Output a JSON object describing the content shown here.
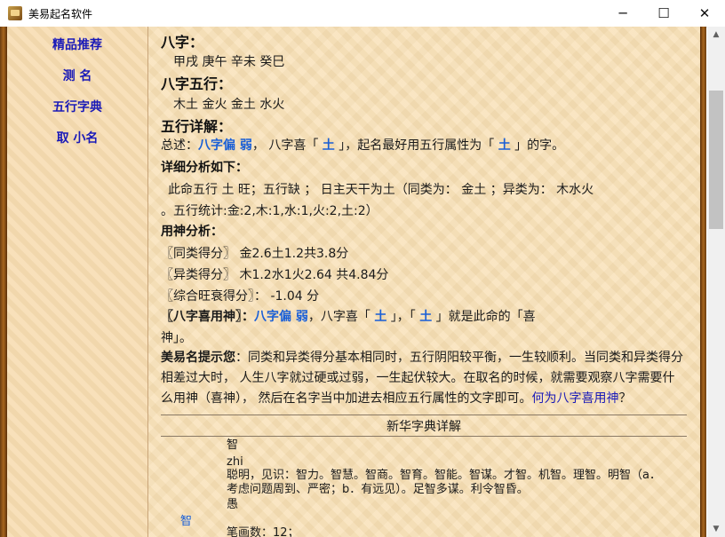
{
  "window": {
    "title": "美易起名软件",
    "minimize_glyph": "─",
    "maximize_glyph": "☐",
    "close_glyph": "✕"
  },
  "sidebar": {
    "items": [
      {
        "label": "精品推荐"
      },
      {
        "label": "测 名"
      },
      {
        "label": "五行字典"
      },
      {
        "label": "取 小名"
      }
    ]
  },
  "content": {
    "bazi_heading": "八字：",
    "bazi_value": "甲戌 庚午 辛未 癸巳",
    "wuxing_heading": "八字五行：",
    "wuxing_value": "木土 金火 金土 水火",
    "detail_heading": "五行详解：",
    "summary": {
      "prefix": "总述：",
      "bazi_strength": "八字偏  弱",
      "mid": "，  八字喜「 ",
      "xi": "土",
      "mid2": " 」，起名最好用五行属性为「 ",
      "element": "土",
      "suffix": " 」的字。"
    },
    "analysis_heading": "详细分析如下：",
    "analysis_line1": "此命五行  土  旺；五行缺 ；  日主天干为土（同类为：  金土 ；异类为：  木水火",
    "analysis_line2": "。五行统计:金:2,木:1,水:1,火:2,土:2）",
    "yongshen_heading": "用神分析：",
    "same_score": "〖同类得分〗  金2.6土1.2共3.8分",
    "diff_score": "〖异类得分〗  木1.2水1火2.64 共4.84分",
    "total_score": "〖综合旺衰得分〗：  -1.04 分",
    "xiyong": {
      "label": "〖八字喜用神〗：",
      "strength": "八字偏  弱",
      "mid": "，八字喜「 ",
      "xi1": "土",
      "mid2": " 」，「 ",
      "xi2": "土",
      "suffix_line1": " 」就是此命的「喜",
      "suffix_line2": "神」。"
    },
    "tip": {
      "label": "美易名提示您",
      "text": "：同类和异类得分基本相同时，五行阴阳较平衡，一生较顺利。当同类和异类得分相差过大时， 人生八字就过硬或过弱，一生起伏较大。在取名的时候，就需要观察八字需要什么用神（喜神）， 然后在名字当中加进去相应五行属性的文字即可。",
      "link": "何为八字喜用神",
      "end": "？"
    },
    "dict": {
      "title": "新华字典详解",
      "char": "智",
      "char_small": "智",
      "pinyin": "zhi",
      "meaning_line1": "聪明，见识：智力。智慧。智商。智育。智能。智谋。才智。机智。理智。明智（a．",
      "meaning_line2": "考虑问题周到、严密；b．有远见）。足智多谋。利令智昏。",
      "antonym": "愚",
      "strokes": "笔画数：12；"
    }
  },
  "scrollbar": {
    "up_glyph": "▲",
    "down_glyph": "▼"
  }
}
